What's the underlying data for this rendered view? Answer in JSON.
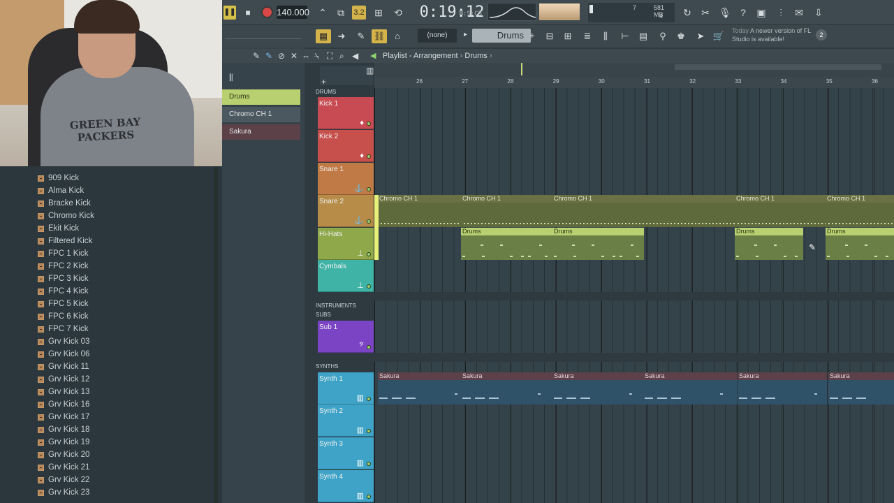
{
  "transport": {
    "tempo": "140.000",
    "time": "0:19:12",
    "time_unit": "M:S:CS",
    "cpu_num": "7",
    "ram": "581 MB",
    "voices": "4",
    "pattern_mode": "3.2"
  },
  "toolbar2": {
    "pattern_selector": "(none)",
    "current_pattern": "Drums",
    "news_title": "Today",
    "news_text": "A newer version of FL Studio is available!",
    "news_count": "2"
  },
  "playlist": {
    "title": "Playlist - Arrangement",
    "crumb": "Drums",
    "ruler": [
      "26",
      "27",
      "28",
      "29",
      "30",
      "31",
      "32",
      "33",
      "34",
      "35",
      "36"
    ]
  },
  "picker": [
    {
      "label": "Drums",
      "color": "#b8d070"
    },
    {
      "label": "Chromo CH 1",
      "color": "#4b5860"
    },
    {
      "label": "Sakura",
      "color": "#5c4148"
    }
  ],
  "groups": {
    "drums": "DRUMS",
    "instruments": "INSTRUMENTS",
    "subs": "SUBS",
    "synths": "SYNTHS"
  },
  "tracks": [
    {
      "name": "Kick 1",
      "color": "#c84a52"
    },
    {
      "name": "Kick 2",
      "color": "#c8504c"
    },
    {
      "name": "Snare 1",
      "color": "#c07a46"
    },
    {
      "name": "Snare 2",
      "color": "#b78c48"
    },
    {
      "name": "Hi-Hats",
      "color": "#8ea84a"
    },
    {
      "name": "Cymbals",
      "color": "#3fb3a6"
    },
    {
      "name": "Sub 1",
      "color": "#7a44c4"
    },
    {
      "name": "Synth 1",
      "color": "#3ea3c7"
    },
    {
      "name": "Synth 2",
      "color": "#3ea3c7"
    },
    {
      "name": "Synth 3",
      "color": "#3ea3c7"
    },
    {
      "name": "Synth 4",
      "color": "#3ea3c7"
    }
  ],
  "clips": {
    "chromo": "Chromo CH 1",
    "drums": "Drums",
    "sakura": "Sakura"
  },
  "browser": [
    "909 Kick",
    "Alma Kick",
    "Bracke Kick",
    "Chromo Kick",
    "Ekit Kick",
    "Filtered Kick",
    "FPC 1 Kick",
    "FPC 2 Kick",
    "FPC 3 Kick",
    "FPC 4 Kick",
    "FPC 5 Kick",
    "FPC 6 Kick",
    "FPC 7 Kick",
    "Grv Kick 03",
    "Grv Kick 06",
    "Grv Kick 11",
    "Grv Kick 12",
    "Grv Kick 13",
    "Grv Kick 16",
    "Grv Kick 17",
    "Grv Kick 18",
    "Grv Kick 19",
    "Grv Kick 20",
    "Grv Kick 21",
    "Grv Kick 22",
    "Grv Kick 23"
  ],
  "webcam": {
    "shirt_text": "GREEN BAY PACKERS"
  }
}
